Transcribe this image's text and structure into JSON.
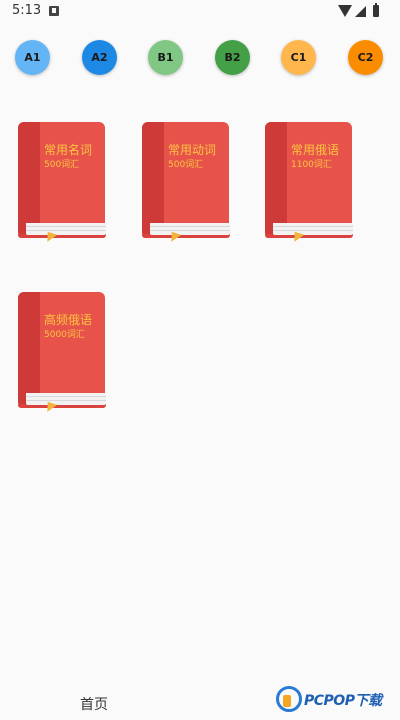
{
  "status_bar": {
    "time": "5:13"
  },
  "levels": [
    {
      "label": "A1",
      "color": "#64b5f6"
    },
    {
      "label": "A2",
      "color": "#1e88e5"
    },
    {
      "label": "B1",
      "color": "#81c784"
    },
    {
      "label": "B2",
      "color": "#43a047"
    },
    {
      "label": "C1",
      "color": "#ffb74d"
    },
    {
      "label": "C2",
      "color": "#fb8c00"
    }
  ],
  "books": [
    {
      "title": "常用名词",
      "count": "500词汇"
    },
    {
      "title": "常用动词",
      "count": "500词汇"
    },
    {
      "title": "常用俄语",
      "count": "1100词汇"
    },
    {
      "title": "高频俄语",
      "count": "5000词汇"
    }
  ],
  "bottom_nav": {
    "home_label": "首页"
  },
  "watermark": {
    "text": "PCPOP下载"
  },
  "colors": {
    "book_cover": "#e7534a",
    "book_spine": "#cd3a37",
    "book_text": "#f9c640",
    "background": "#fafafa"
  }
}
